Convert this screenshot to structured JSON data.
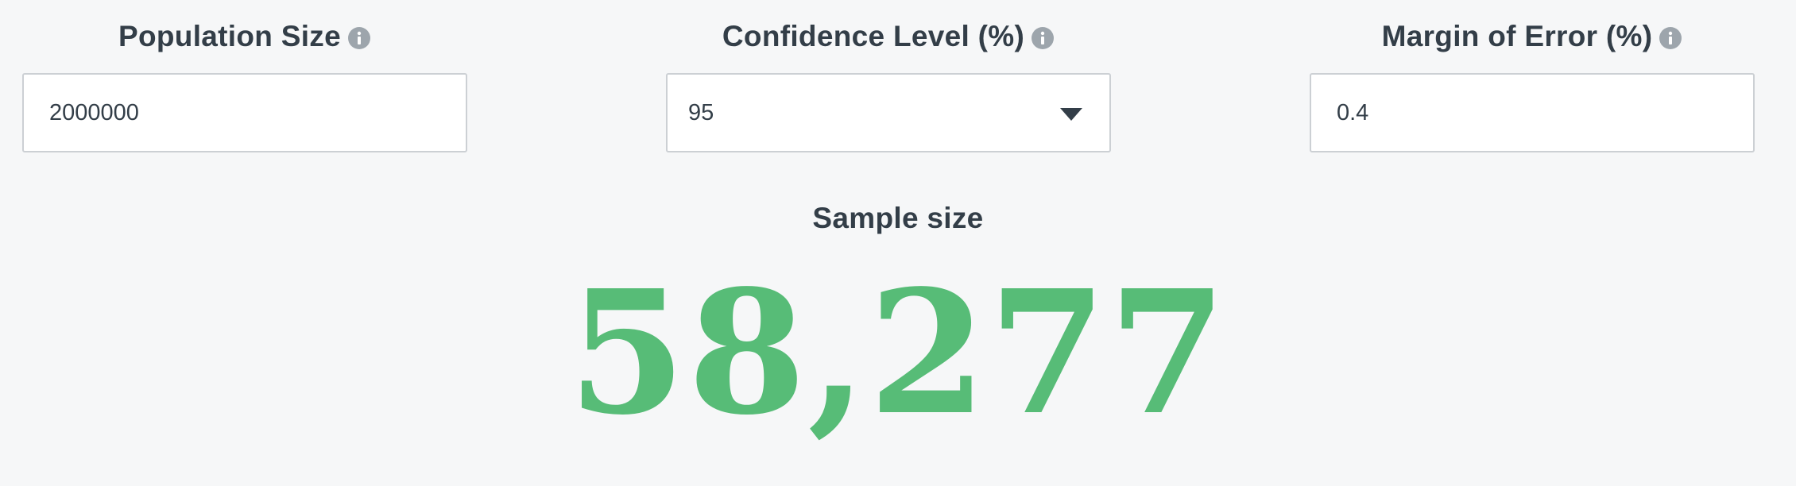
{
  "fields": {
    "population": {
      "label": "Population Size",
      "value": "2000000",
      "info_icon": "info-icon"
    },
    "confidence": {
      "label": "Confidence Level (%)",
      "selected": "95",
      "info_icon": "info-icon",
      "dropdown_icon": "caret-down-icon"
    },
    "margin": {
      "label": "Margin of Error (%)",
      "value": "0.4",
      "info_icon": "info-icon"
    }
  },
  "result": {
    "label": "Sample size",
    "value": "58,277"
  },
  "colors": {
    "background": "#f6f7f8",
    "text": "#333e48",
    "result_green": "#57bc77",
    "info_icon": "#9da5ac",
    "input_border": "#ccd0d4"
  }
}
